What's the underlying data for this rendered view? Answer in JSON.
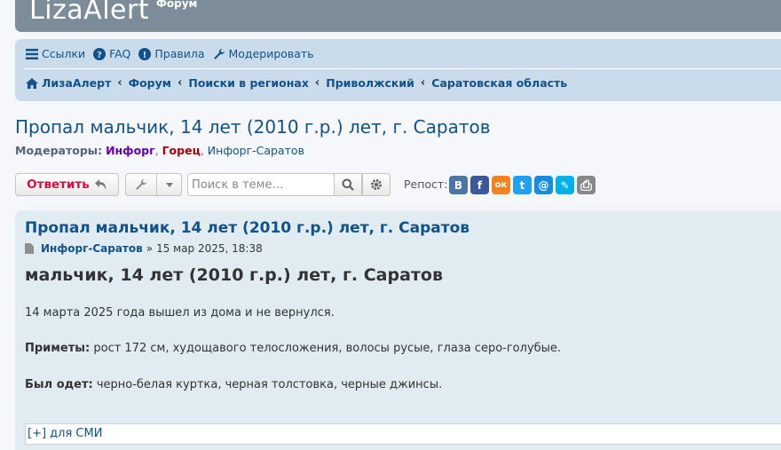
{
  "header": {
    "logo_text": "LizaAlert",
    "forum_label": "Форум"
  },
  "quicklinks": [
    {
      "icon": "menu-icon",
      "label": "Ссылки"
    },
    {
      "icon": "question-circle-icon",
      "label": "FAQ"
    },
    {
      "icon": "exclamation-circle-icon",
      "label": "Правила"
    },
    {
      "icon": "wrench-icon",
      "label": "Модерировать"
    }
  ],
  "breadcrumbs": [
    "ЛизаАлерт",
    "Форум",
    "Поиски в регионах",
    "Приволжский",
    "Саратовская область"
  ],
  "topic": {
    "title": "Пропал мальчик, 14 лет (2010 г.р.) лет, г. Саратов",
    "moderators_label": "Модераторы:",
    "moderators": [
      "Инфорг",
      "Горец",
      "Инфорг-Саратов"
    ]
  },
  "actions": {
    "reply_label": "Ответить",
    "search_placeholder": "Поиск в теме…",
    "repost_label": "Репост:",
    "social": [
      {
        "icon": "vk-icon",
        "glyph": "В",
        "color": "#4a76a8"
      },
      {
        "icon": "facebook-icon",
        "glyph": "f",
        "color": "#3b5998"
      },
      {
        "icon": "odnoklassniki-icon",
        "glyph": "ок",
        "color": "#f58220"
      },
      {
        "icon": "twitter-icon",
        "glyph": "t",
        "color": "#1da1f2"
      },
      {
        "icon": "mailru-icon",
        "glyph": "@",
        "color": "#168de2"
      },
      {
        "icon": "livejournal-icon",
        "glyph": "✎",
        "color": "#00b0ea"
      },
      {
        "icon": "print-icon",
        "glyph": "⎙",
        "color": "#888888"
      }
    ]
  },
  "post": {
    "title": "Пропал мальчик, 14 лет (2010 г.р.) лет, г. Саратов",
    "author": "Инфорг-Саратов",
    "date_sep": "»",
    "date": "15 мар 2025, 18:38",
    "heading": "мальчик, 14 лет (2010 г.р.) лет, г. Саратов",
    "p1": "14 марта 2025 года вышел из дома и не вернулся.",
    "p2_label": "Приметы:",
    "p2_text": " рост 172 см, худощавого телосложения, волосы русые, глаза серо-голубые.",
    "p3_label": "Был одет:",
    "p3_text": " черно-белая куртка, черная толстовка, черные джинсы.",
    "spoiler_label": "[+] для СМИ"
  }
}
